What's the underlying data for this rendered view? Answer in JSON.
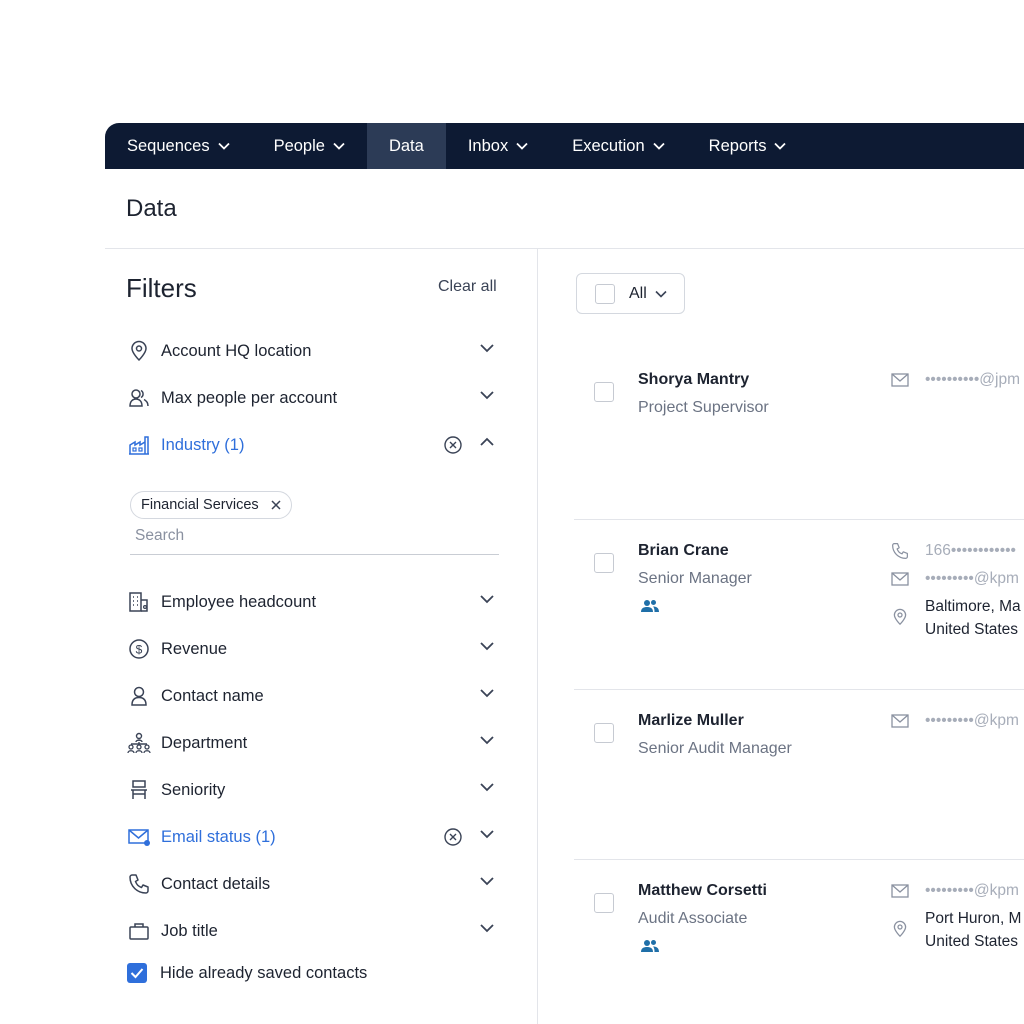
{
  "nav": {
    "items": [
      {
        "label": "Sequences",
        "dropdown": true
      },
      {
        "label": "People",
        "dropdown": true
      },
      {
        "label": "Data",
        "dropdown": false,
        "active": true
      },
      {
        "label": "Inbox",
        "dropdown": true
      },
      {
        "label": "Execution",
        "dropdown": true
      },
      {
        "label": "Reports",
        "dropdown": true
      }
    ]
  },
  "page": {
    "title": "Data"
  },
  "filters": {
    "heading": "Filters",
    "clear_all": "Clear all",
    "items": [
      {
        "label": "Account HQ location",
        "icon": "location-pin-icon"
      },
      {
        "label": "Max people per account",
        "icon": "people-icon"
      },
      {
        "label": "Industry (1)",
        "icon": "factory-icon",
        "active": true,
        "expanded": true
      },
      {
        "label": "Employee headcount",
        "icon": "building-icon"
      },
      {
        "label": "Revenue",
        "icon": "dollar-icon"
      },
      {
        "label": "Contact name",
        "icon": "person-icon"
      },
      {
        "label": "Department",
        "icon": "org-chart-icon"
      },
      {
        "label": "Seniority",
        "icon": "seniority-icon"
      },
      {
        "label": "Email status (1)",
        "icon": "email-status-icon",
        "active": true
      },
      {
        "label": "Contact details",
        "icon": "phone-icon"
      },
      {
        "label": "Job title",
        "icon": "briefcase-icon"
      }
    ],
    "industry_chip": "Financial Services",
    "search_placeholder": "Search",
    "hide_saved": {
      "label": "Hide already saved contacts",
      "checked": true
    }
  },
  "results": {
    "select_all_label": "All",
    "contacts": [
      {
        "name": "Shorya Mantry",
        "title": "Project Supervisor",
        "email": "••••••••••@jpm"
      },
      {
        "name": "Brian Crane",
        "title": "Senior Manager",
        "phone": "166••••••••••••",
        "email": "•••••••••@kpm",
        "location_line1": "Baltimore, Ma",
        "location_line2": "United States"
      },
      {
        "name": "Marlize Muller",
        "title": "Senior Audit Manager",
        "email": "•••••••••@kpm"
      },
      {
        "name": "Matthew Corsetti",
        "title": "Audit Associate",
        "email": "•••••••••@kpm",
        "location_line1": "Port Huron, M",
        "location_line2": "United States"
      }
    ]
  },
  "colors": {
    "nav_bg": "#0d1a33",
    "nav_active": "#2c3b56",
    "accent_blue": "#2f6fdb",
    "team_icon": "#1f6fa8"
  }
}
